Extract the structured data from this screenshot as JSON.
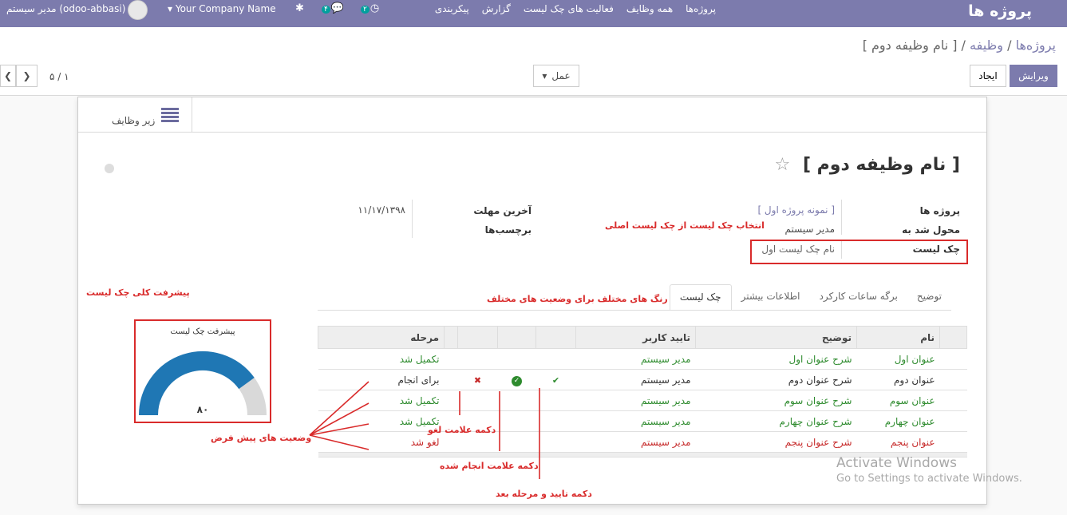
{
  "topbar": {
    "app_title": "پروژه ها",
    "menu": [
      "پروژه‌ها",
      "همه وظایف",
      "فعالیت های چک لیست",
      "گزارش",
      "پیکربندی"
    ],
    "company": "Your Company Name",
    "user": "مدیر سیستم (odoo-abbasi)",
    "messages_count": "۴",
    "activities_count": "۲"
  },
  "breadcrumb": {
    "root": "پروژه‌ها",
    "middle": "وظیفه",
    "current": "[ نام وظیفه دوم ]"
  },
  "actions": {
    "edit": "ویرایش",
    "create": "ایجاد",
    "action": "عمل",
    "pager": "۵ / ۱"
  },
  "smart_button": {
    "label": "زیر وظایف"
  },
  "record": {
    "title": "[ نام وظیفه دوم ]",
    "fields": {
      "project_label": "پروژه ها",
      "project_value": "[ نمونه پروژه اول ]",
      "assigned_label": "محول شد به",
      "assigned_value": "مدیر سیستم",
      "checklist_label": "چک لیست",
      "checklist_value": "نام چک لیست اول",
      "deadline_label": "آخرین مهلت",
      "deadline_value": "۱۱/۱۷/۱۳۹۸",
      "tags_label": "برچسب‌ها"
    }
  },
  "tabs": [
    "توضیح",
    "برگه ساعات کارکرد",
    "اطلاعات بیشتر",
    "چک لیست"
  ],
  "checklist_table": {
    "headers": [
      "نام",
      "توضیح",
      "تایید کاربر",
      "",
      "",
      "",
      "مرحله"
    ],
    "rows": [
      {
        "name": "عنوان اول",
        "desc": "شرح عنوان اول",
        "user": "مدیر سیستم",
        "stage": "تکمیل شد",
        "color": "#2e8b2e",
        "actions": false
      },
      {
        "name": "عنوان دوم",
        "desc": "شرح عنوان دوم",
        "user": "مدیر سیستم",
        "stage": "برای انجام",
        "color": "#333333",
        "actions": true
      },
      {
        "name": "عنوان سوم",
        "desc": "شرح عنوان سوم",
        "user": "مدیر سیستم",
        "stage": "تکمیل شد",
        "color": "#2e8b2e",
        "actions": false
      },
      {
        "name": "عنوان چهارم",
        "desc": "شرح عنوان چهارم",
        "user": "مدیر سیستم",
        "stage": "تکمیل شد",
        "color": "#2e8b2e",
        "actions": false
      },
      {
        "name": "عنوان پنجم",
        "desc": "شرح عنوان پنجم",
        "user": "مدیر سیستم",
        "stage": "لغو شد",
        "color": "#c62828",
        "actions": false
      }
    ]
  },
  "gauge": {
    "title": "پیشرفت چک لیست",
    "value": 80,
    "value_label": "۸۰",
    "color": "#1f77b4"
  },
  "annotations": {
    "select_checklist": "انتخاب چک لیست از چک لیست اصلی",
    "overall_progress": "پیشرفت کلی چک لیست",
    "colors": "رنگ های مختلف برای وضعیت های مختلف",
    "default_states": "وضعیت های پیش فرض",
    "cancel_btn": "دکمه علامت لغو",
    "done_btn": "دکمه علامت انجام شده",
    "approve_btn": "دکمه تایید و مرحله بعد"
  },
  "watermark": {
    "line1": "Activate Windows",
    "line2": "Go to Settings to activate Windows."
  }
}
